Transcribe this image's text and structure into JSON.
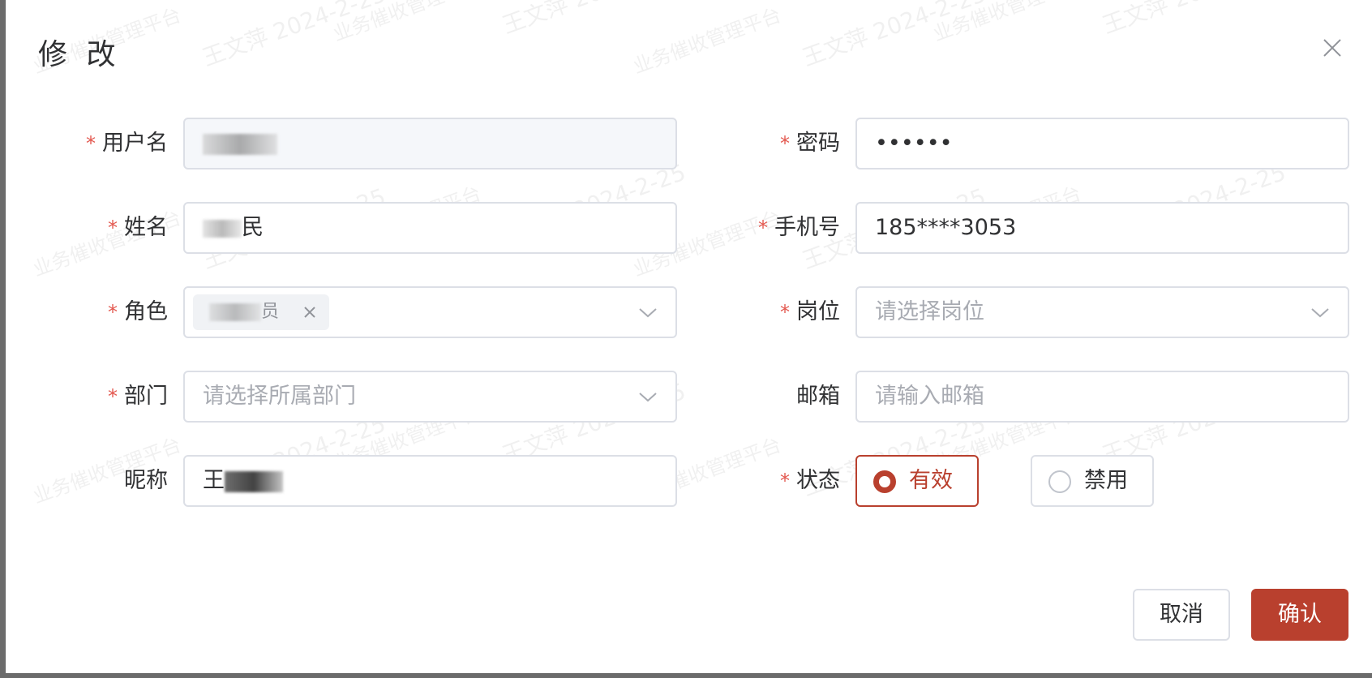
{
  "dialog": {
    "title": "修 改",
    "close_icon": "close-icon"
  },
  "watermark": {
    "line1": "业务催收管理平台",
    "line2": "王文萍 2024-2-25"
  },
  "form": {
    "username": {
      "label": "用户名",
      "required": true,
      "value": "",
      "disabled": true
    },
    "password": {
      "label": "密码",
      "required": true,
      "value": "••••••"
    },
    "name": {
      "label": "姓名",
      "required": true,
      "value_visible_start": "",
      "value_visible_end": "民"
    },
    "phone": {
      "label": "手机号",
      "required": true,
      "value": "185****3053"
    },
    "role": {
      "label": "角色",
      "required": true,
      "tag_suffix": "员",
      "tag_close_icon": "close-icon"
    },
    "position": {
      "label": "岗位",
      "required": true,
      "placeholder": "请选择岗位"
    },
    "department": {
      "label": "部门",
      "required": true,
      "placeholder": "请选择所属部门"
    },
    "email": {
      "label": "邮箱",
      "required": false,
      "placeholder": "请输入邮箱"
    },
    "nickname": {
      "label": "昵称",
      "required": false,
      "value_visible_start": "王"
    },
    "status": {
      "label": "状态",
      "required": true,
      "options": [
        {
          "label": "有效",
          "checked": true
        },
        {
          "label": "禁用",
          "checked": false
        }
      ]
    }
  },
  "footer": {
    "cancel_label": "取消",
    "confirm_label": "确认"
  },
  "colors": {
    "accent": "#b9402e",
    "required_star": "#e3584f",
    "border": "#dcdfe6",
    "placeholder": "#a8abb2"
  }
}
